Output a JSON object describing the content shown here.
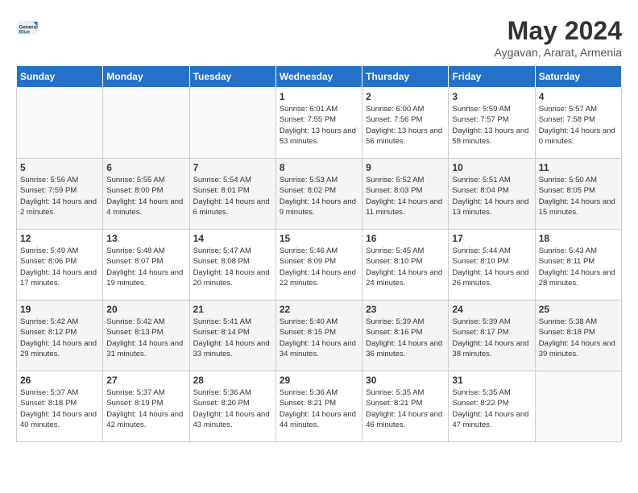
{
  "logo": {
    "general": "General",
    "blue": "Blue"
  },
  "header": {
    "title": "May 2024",
    "subtitle": "Aygavan, Ararat, Armenia"
  },
  "weekdays": [
    "Sunday",
    "Monday",
    "Tuesday",
    "Wednesday",
    "Thursday",
    "Friday",
    "Saturday"
  ],
  "weeks": [
    [
      {
        "day": "",
        "sunrise": "",
        "sunset": "",
        "daylight": ""
      },
      {
        "day": "",
        "sunrise": "",
        "sunset": "",
        "daylight": ""
      },
      {
        "day": "",
        "sunrise": "",
        "sunset": "",
        "daylight": ""
      },
      {
        "day": "1",
        "sunrise": "Sunrise: 6:01 AM",
        "sunset": "Sunset: 7:55 PM",
        "daylight": "Daylight: 13 hours and 53 minutes."
      },
      {
        "day": "2",
        "sunrise": "Sunrise: 6:00 AM",
        "sunset": "Sunset: 7:56 PM",
        "daylight": "Daylight: 13 hours and 56 minutes."
      },
      {
        "day": "3",
        "sunrise": "Sunrise: 5:59 AM",
        "sunset": "Sunset: 7:57 PM",
        "daylight": "Daylight: 13 hours and 58 minutes."
      },
      {
        "day": "4",
        "sunrise": "Sunrise: 5:57 AM",
        "sunset": "Sunset: 7:58 PM",
        "daylight": "Daylight: 14 hours and 0 minutes."
      }
    ],
    [
      {
        "day": "5",
        "sunrise": "Sunrise: 5:56 AM",
        "sunset": "Sunset: 7:59 PM",
        "daylight": "Daylight: 14 hours and 2 minutes."
      },
      {
        "day": "6",
        "sunrise": "Sunrise: 5:55 AM",
        "sunset": "Sunset: 8:00 PM",
        "daylight": "Daylight: 14 hours and 4 minutes."
      },
      {
        "day": "7",
        "sunrise": "Sunrise: 5:54 AM",
        "sunset": "Sunset: 8:01 PM",
        "daylight": "Daylight: 14 hours and 6 minutes."
      },
      {
        "day": "8",
        "sunrise": "Sunrise: 5:53 AM",
        "sunset": "Sunset: 8:02 PM",
        "daylight": "Daylight: 14 hours and 9 minutes."
      },
      {
        "day": "9",
        "sunrise": "Sunrise: 5:52 AM",
        "sunset": "Sunset: 8:03 PM",
        "daylight": "Daylight: 14 hours and 11 minutes."
      },
      {
        "day": "10",
        "sunrise": "Sunrise: 5:51 AM",
        "sunset": "Sunset: 8:04 PM",
        "daylight": "Daylight: 14 hours and 13 minutes."
      },
      {
        "day": "11",
        "sunrise": "Sunrise: 5:50 AM",
        "sunset": "Sunset: 8:05 PM",
        "daylight": "Daylight: 14 hours and 15 minutes."
      }
    ],
    [
      {
        "day": "12",
        "sunrise": "Sunrise: 5:49 AM",
        "sunset": "Sunset: 8:06 PM",
        "daylight": "Daylight: 14 hours and 17 minutes."
      },
      {
        "day": "13",
        "sunrise": "Sunrise: 5:48 AM",
        "sunset": "Sunset: 8:07 PM",
        "daylight": "Daylight: 14 hours and 19 minutes."
      },
      {
        "day": "14",
        "sunrise": "Sunrise: 5:47 AM",
        "sunset": "Sunset: 8:08 PM",
        "daylight": "Daylight: 14 hours and 20 minutes."
      },
      {
        "day": "15",
        "sunrise": "Sunrise: 5:46 AM",
        "sunset": "Sunset: 8:09 PM",
        "daylight": "Daylight: 14 hours and 22 minutes."
      },
      {
        "day": "16",
        "sunrise": "Sunrise: 5:45 AM",
        "sunset": "Sunset: 8:10 PM",
        "daylight": "Daylight: 14 hours and 24 minutes."
      },
      {
        "day": "17",
        "sunrise": "Sunrise: 5:44 AM",
        "sunset": "Sunset: 8:10 PM",
        "daylight": "Daylight: 14 hours and 26 minutes."
      },
      {
        "day": "18",
        "sunrise": "Sunrise: 5:43 AM",
        "sunset": "Sunset: 8:11 PM",
        "daylight": "Daylight: 14 hours and 28 minutes."
      }
    ],
    [
      {
        "day": "19",
        "sunrise": "Sunrise: 5:42 AM",
        "sunset": "Sunset: 8:12 PM",
        "daylight": "Daylight: 14 hours and 29 minutes."
      },
      {
        "day": "20",
        "sunrise": "Sunrise: 5:42 AM",
        "sunset": "Sunset: 8:13 PM",
        "daylight": "Daylight: 14 hours and 31 minutes."
      },
      {
        "day": "21",
        "sunrise": "Sunrise: 5:41 AM",
        "sunset": "Sunset: 8:14 PM",
        "daylight": "Daylight: 14 hours and 33 minutes."
      },
      {
        "day": "22",
        "sunrise": "Sunrise: 5:40 AM",
        "sunset": "Sunset: 8:15 PM",
        "daylight": "Daylight: 14 hours and 34 minutes."
      },
      {
        "day": "23",
        "sunrise": "Sunrise: 5:39 AM",
        "sunset": "Sunset: 8:16 PM",
        "daylight": "Daylight: 14 hours and 36 minutes."
      },
      {
        "day": "24",
        "sunrise": "Sunrise: 5:39 AM",
        "sunset": "Sunset: 8:17 PM",
        "daylight": "Daylight: 14 hours and 38 minutes."
      },
      {
        "day": "25",
        "sunrise": "Sunrise: 5:38 AM",
        "sunset": "Sunset: 8:18 PM",
        "daylight": "Daylight: 14 hours and 39 minutes."
      }
    ],
    [
      {
        "day": "26",
        "sunrise": "Sunrise: 5:37 AM",
        "sunset": "Sunset: 8:18 PM",
        "daylight": "Daylight: 14 hours and 40 minutes."
      },
      {
        "day": "27",
        "sunrise": "Sunrise: 5:37 AM",
        "sunset": "Sunset: 8:19 PM",
        "daylight": "Daylight: 14 hours and 42 minutes."
      },
      {
        "day": "28",
        "sunrise": "Sunrise: 5:36 AM",
        "sunset": "Sunset: 8:20 PM",
        "daylight": "Daylight: 14 hours and 43 minutes."
      },
      {
        "day": "29",
        "sunrise": "Sunrise: 5:36 AM",
        "sunset": "Sunset: 8:21 PM",
        "daylight": "Daylight: 14 hours and 44 minutes."
      },
      {
        "day": "30",
        "sunrise": "Sunrise: 5:35 AM",
        "sunset": "Sunset: 8:21 PM",
        "daylight": "Daylight: 14 hours and 46 minutes."
      },
      {
        "day": "31",
        "sunrise": "Sunrise: 5:35 AM",
        "sunset": "Sunset: 8:22 PM",
        "daylight": "Daylight: 14 hours and 47 minutes."
      },
      {
        "day": "",
        "sunrise": "",
        "sunset": "",
        "daylight": ""
      }
    ]
  ]
}
